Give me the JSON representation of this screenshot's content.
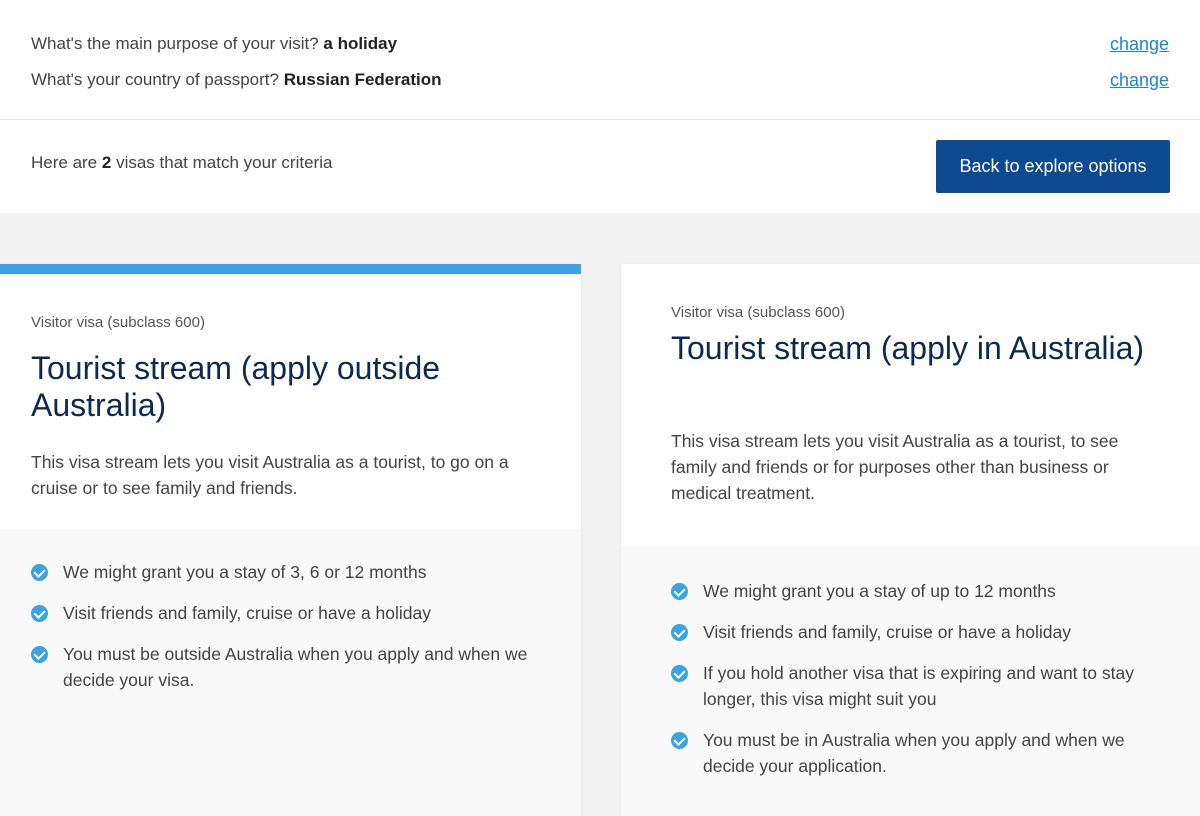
{
  "criteria": {
    "purpose_question": "What's the main purpose of your visit?",
    "purpose_answer": "a holiday",
    "passport_question": "What's your country of passport?",
    "passport_answer": "Russian Federation",
    "change_label": "change"
  },
  "results": {
    "prefix": "Here are",
    "count": "2",
    "suffix": "visas that match your criteria",
    "back_button": "Back to explore options"
  },
  "cards": [
    {
      "subclass": "Visitor visa (subclass 600)",
      "title": "Tourist stream (apply outside Australia)",
      "description": "This visa stream lets you visit Australia as a tourist, to go on a cruise or to see family and friends.",
      "benefits": [
        "We might grant you a stay of 3, 6 or 12 months",
        "Visit friends and family, cruise or have a holiday",
        "You must be outside Australia when you apply and when we decide your visa."
      ]
    },
    {
      "subclass": "Visitor visa (subclass 600)",
      "title": "Tourist stream (apply in Australia)",
      "description": "This visa stream lets you visit Australia as a tourist, to see family and friends or for purposes other than business or medical treatment.",
      "benefits": [
        "We might grant you a stay of up to 12 months",
        "Visit friends and family, cruise or have a holiday",
        "If you hold another visa that is expiring and want to stay longer, this visa might suit you",
        "You must be in Australia when you apply and when we decide your application."
      ]
    }
  ],
  "colors": {
    "accent": "#3aa3e3",
    "button": "#0d4a8f",
    "title": "#0c2a4d",
    "link": "#1b84d4"
  }
}
